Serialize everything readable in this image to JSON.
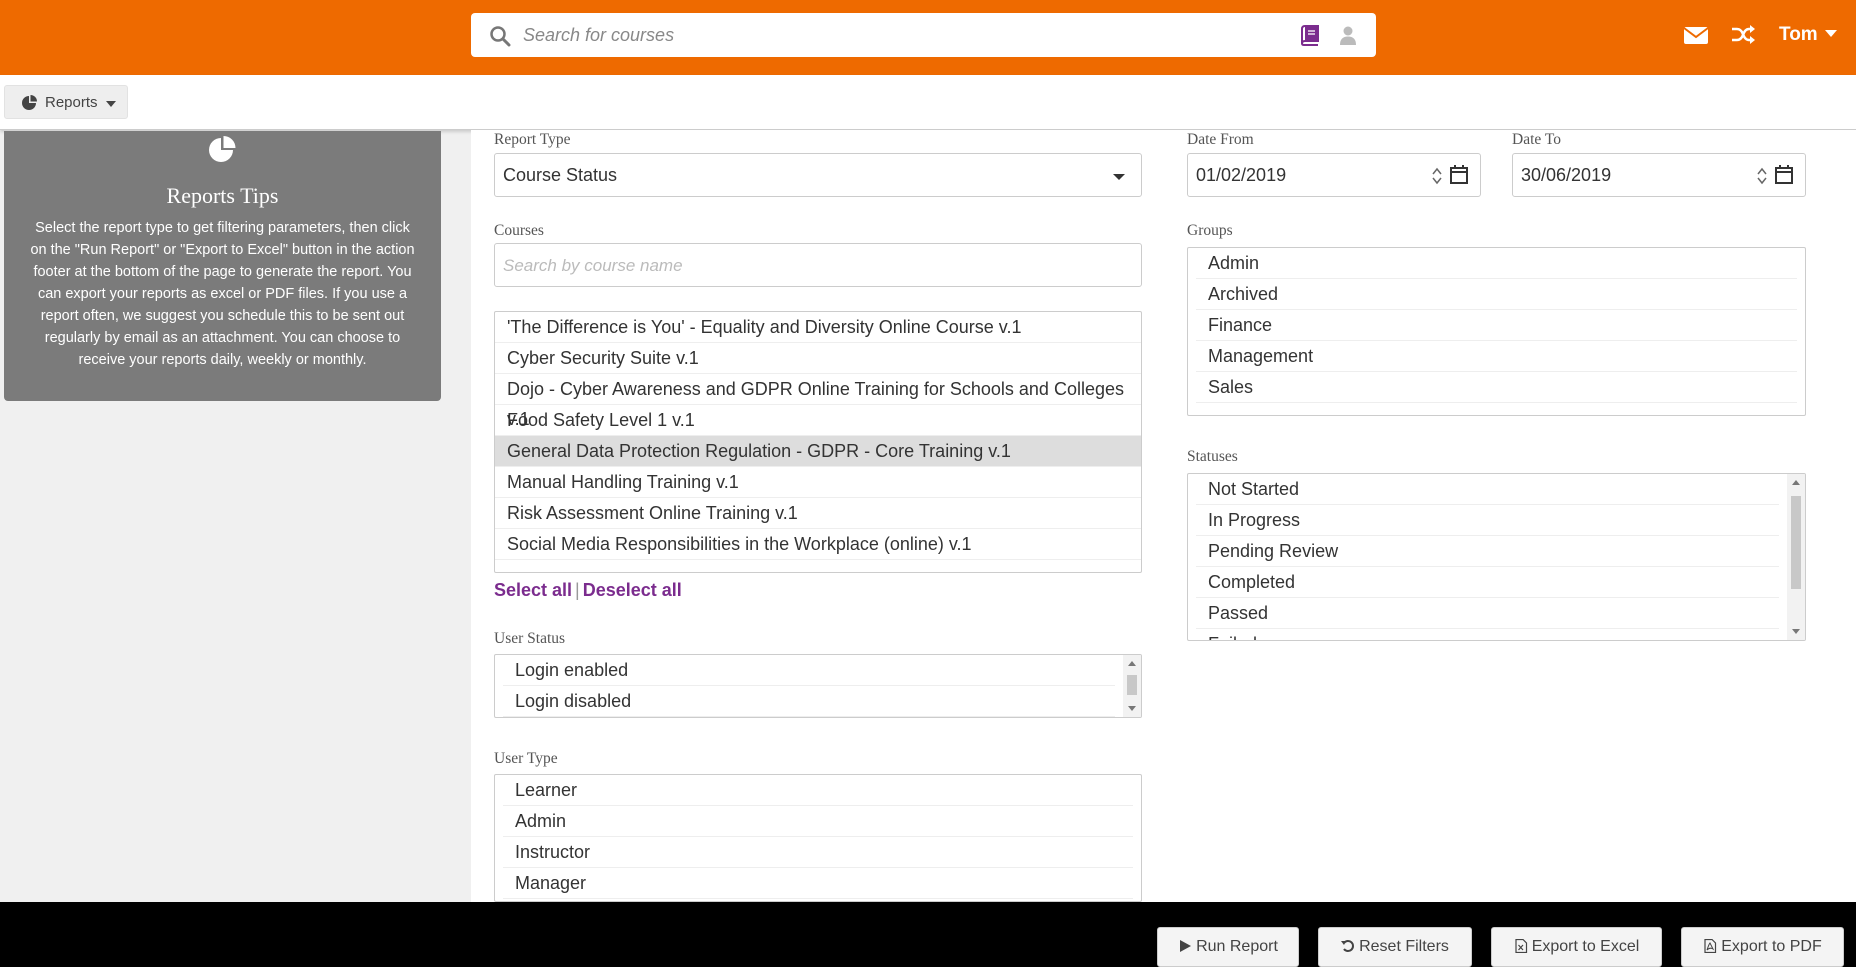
{
  "header": {
    "search_placeholder": "Search for courses",
    "user_name": "Tom",
    "brand_color": "#ee6a00"
  },
  "subnav": {
    "reports_label": "Reports"
  },
  "tips": {
    "title": "Reports Tips",
    "text": "Select the report type to get filtering parameters, then click on the \"Run Report\" or \"Export to Excel\" button in the action footer at the bottom of the page to generate the report. You can export your reports as excel or PDF files. If you use a report often, we suggest you schedule this to be sent out regularly by email as an attachment. You can choose to receive your reports daily, weekly or monthly."
  },
  "form": {
    "report_type": {
      "label": "Report Type",
      "value": "Course Status"
    },
    "date_from": {
      "label": "Date From",
      "value": "01/02/2019"
    },
    "date_to": {
      "label": "Date To",
      "value": "30/06/2019"
    },
    "courses": {
      "label": "Courses",
      "search_placeholder": "Search by course name",
      "items": [
        "'The Difference is You' - Equality and Diversity Online Course v.1",
        "Cyber Security Suite v.1",
        "Dojo - Cyber Awareness and GDPR Online Training for Schools and Colleges v.1",
        "Food Safety Level 1 v.1",
        "General Data Protection Regulation - GDPR - Core Training v.1",
        "Manual Handling Training v.1",
        "Risk Assessment Online Training v.1",
        "Social Media Responsibilities in the Workplace (online) v.1"
      ],
      "selected_index": 4,
      "select_all": "Select all",
      "separator": "|",
      "deselect_all": "Deselect all"
    },
    "groups": {
      "label": "Groups",
      "items": [
        "Admin",
        "Archived",
        "Finance",
        "Management",
        "Sales"
      ]
    },
    "statuses": {
      "label": "Statuses",
      "items": [
        "Not Started",
        "In Progress",
        "Pending Review",
        "Completed",
        "Passed",
        "Failed"
      ]
    },
    "user_status": {
      "label": "User Status",
      "items": [
        "Login enabled",
        "Login disabled"
      ]
    },
    "user_type": {
      "label": "User Type",
      "items": [
        "Learner",
        "Admin",
        "Instructor",
        "Manager"
      ]
    }
  },
  "footer": {
    "run_report": "Run Report",
    "reset_filters": "Reset Filters",
    "export_excel": "Export to Excel",
    "export_pdf": "Export to PDF"
  }
}
